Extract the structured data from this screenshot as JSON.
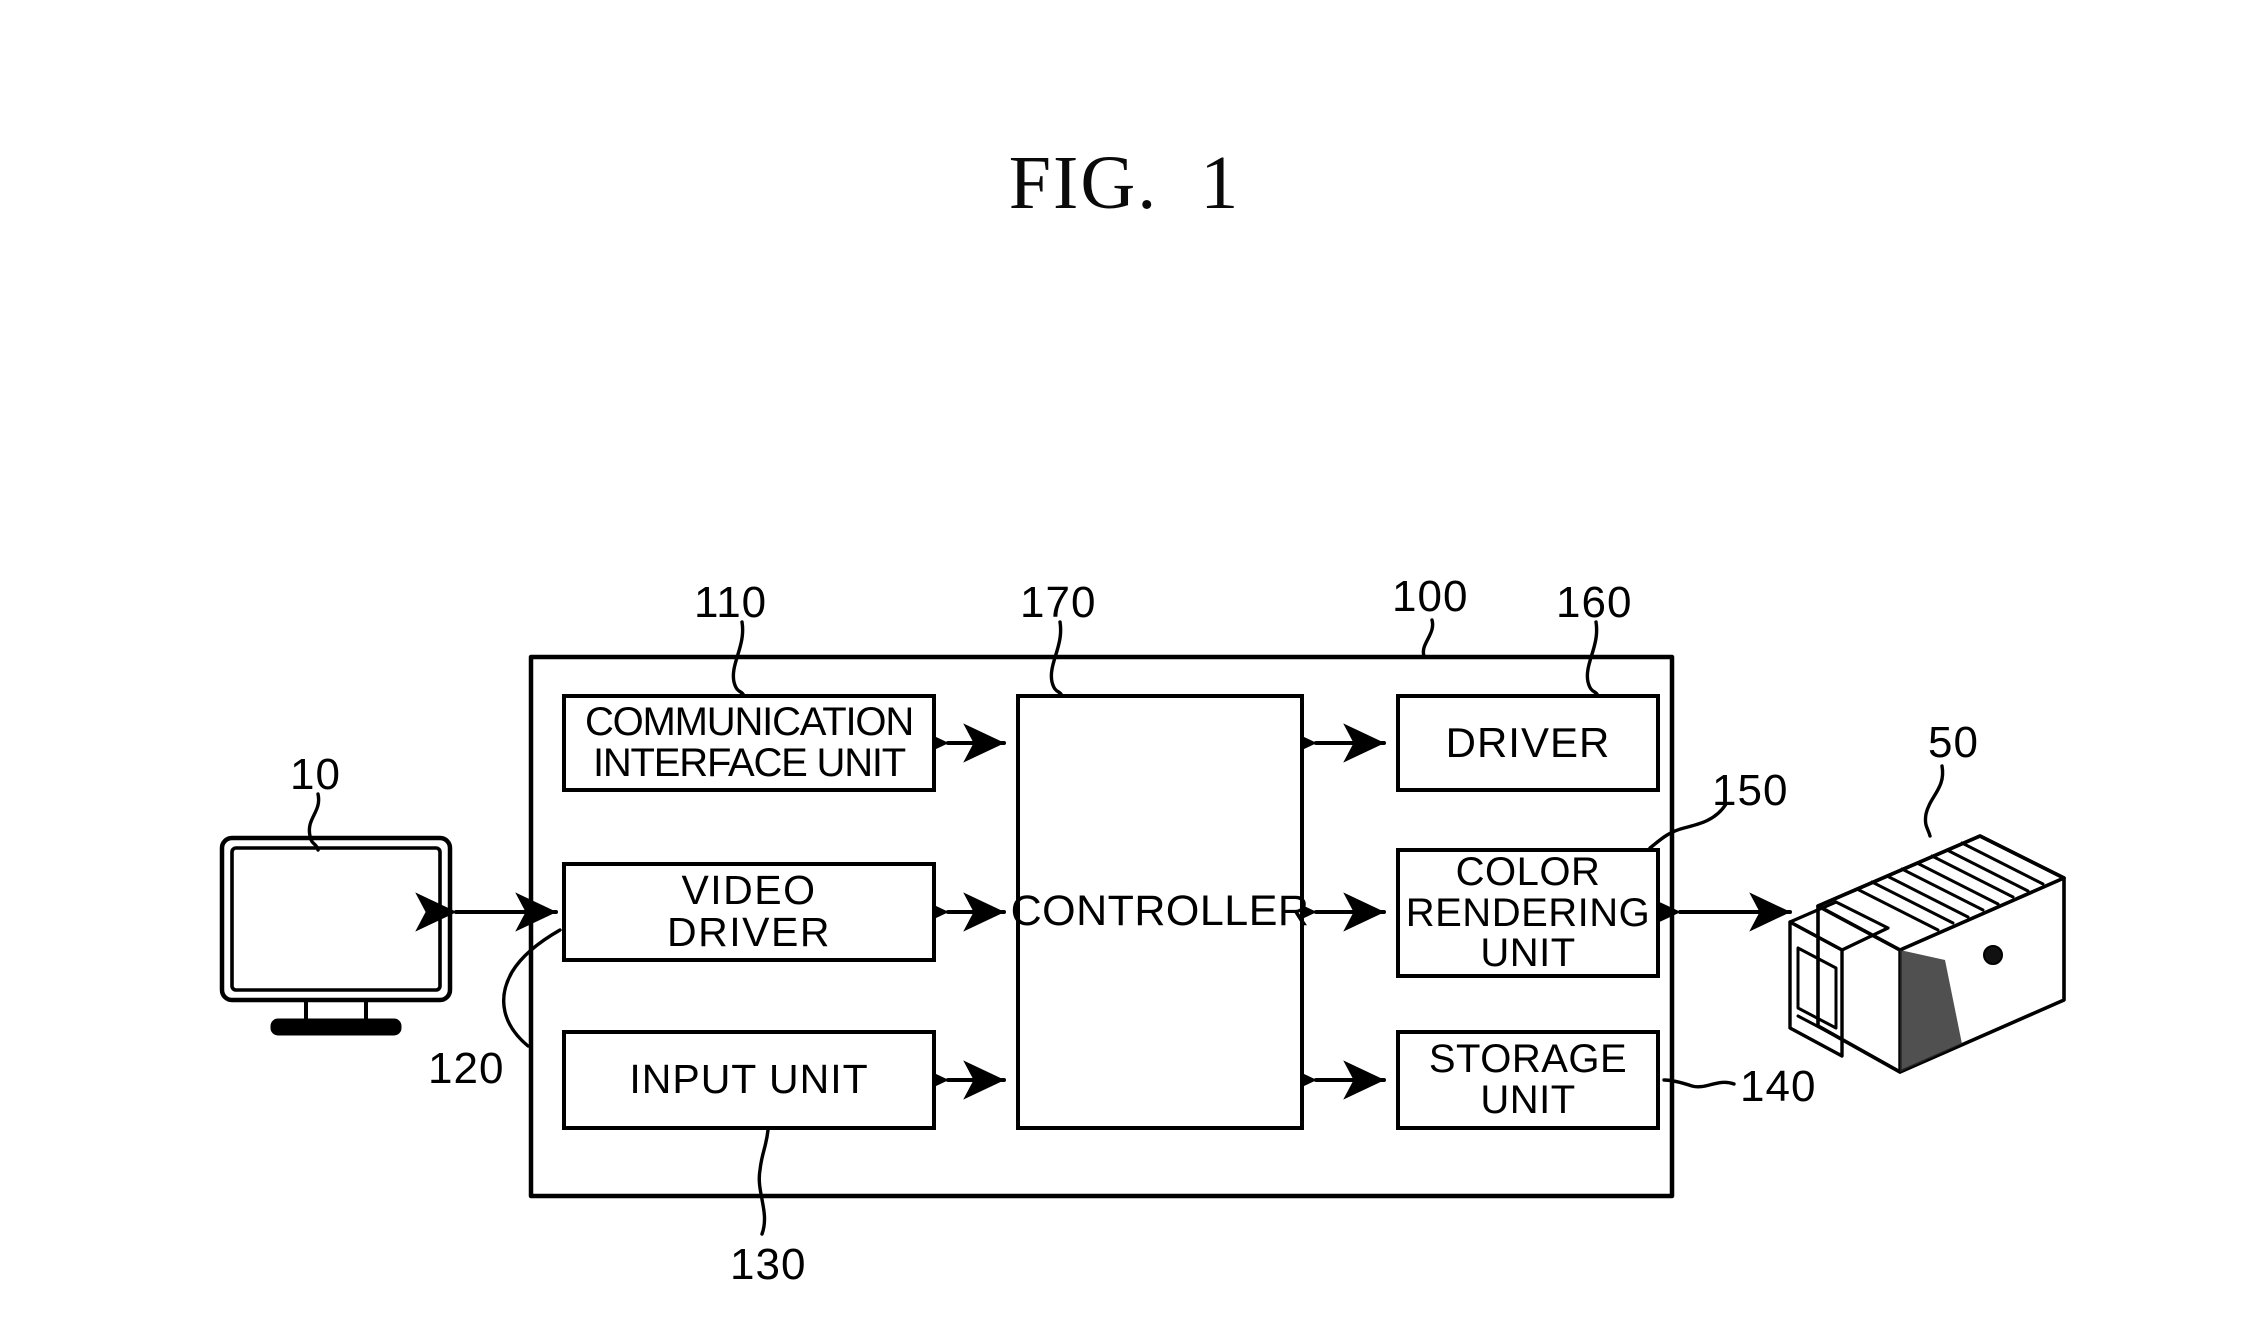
{
  "figure": {
    "title": "FIG.  1",
    "type": "patent-block-diagram"
  },
  "blocks": [
    {
      "id": "communication-interface-unit",
      "label": "COMMUNICATION\nINTERFACE UNIT",
      "ref": "110",
      "column": "left",
      "row": 1
    },
    {
      "id": "video-driver",
      "label": "VIDEO\nDRIVER",
      "ref": "120",
      "column": "left",
      "row": 2
    },
    {
      "id": "input-unit",
      "label": "INPUT UNIT",
      "ref": "130",
      "column": "left",
      "row": 3
    },
    {
      "id": "controller",
      "label": "CONTROLLER",
      "ref": "170",
      "column": "center",
      "row": 0
    },
    {
      "id": "driver",
      "label": "DRIVER",
      "ref": "160",
      "column": "right",
      "row": 1
    },
    {
      "id": "color-rendering-unit",
      "label": "COLOR\nRENDERING\nUNIT",
      "ref": "150",
      "column": "right",
      "row": 2
    },
    {
      "id": "storage-unit",
      "label": "STORAGE\nUNIT",
      "ref": "140",
      "column": "right",
      "row": 3
    }
  ],
  "container": {
    "id": "image-forming-apparatus",
    "ref": "100"
  },
  "peripherals": [
    {
      "id": "display-monitor",
      "ref": "10",
      "side": "left"
    },
    {
      "id": "printer",
      "ref": "50",
      "side": "right"
    }
  ],
  "labels": {
    "comm": "COMMUNICATION\nINTERFACE UNIT",
    "video": "VIDEO\nDRIVER",
    "input": "INPUT UNIT",
    "ctrl": "CONTROLLER",
    "driver": "DRIVER",
    "color": "COLOR\nRENDERING\nUNIT",
    "storage": "STORAGE\nUNIT"
  },
  "refs": {
    "r110": "110",
    "r170": "170",
    "r100": "100",
    "r160": "160",
    "r10": "10",
    "r120": "120",
    "r130": "130",
    "r150": "150",
    "r140": "140",
    "r50": "50"
  },
  "connections": [
    {
      "from": "display-monitor",
      "to": "video-driver",
      "arrow": "double"
    },
    {
      "from": "communication-interface-unit",
      "to": "controller",
      "arrow": "double"
    },
    {
      "from": "video-driver",
      "to": "controller",
      "arrow": "double"
    },
    {
      "from": "input-unit",
      "to": "controller",
      "arrow": "double"
    },
    {
      "from": "controller",
      "to": "driver",
      "arrow": "double"
    },
    {
      "from": "controller",
      "to": "color-rendering-unit",
      "arrow": "double"
    },
    {
      "from": "controller",
      "to": "storage-unit",
      "arrow": "double"
    },
    {
      "from": "color-rendering-unit",
      "to": "printer",
      "arrow": "double"
    }
  ],
  "colors": {
    "ink": "#000000",
    "paper": "#ffffff"
  }
}
